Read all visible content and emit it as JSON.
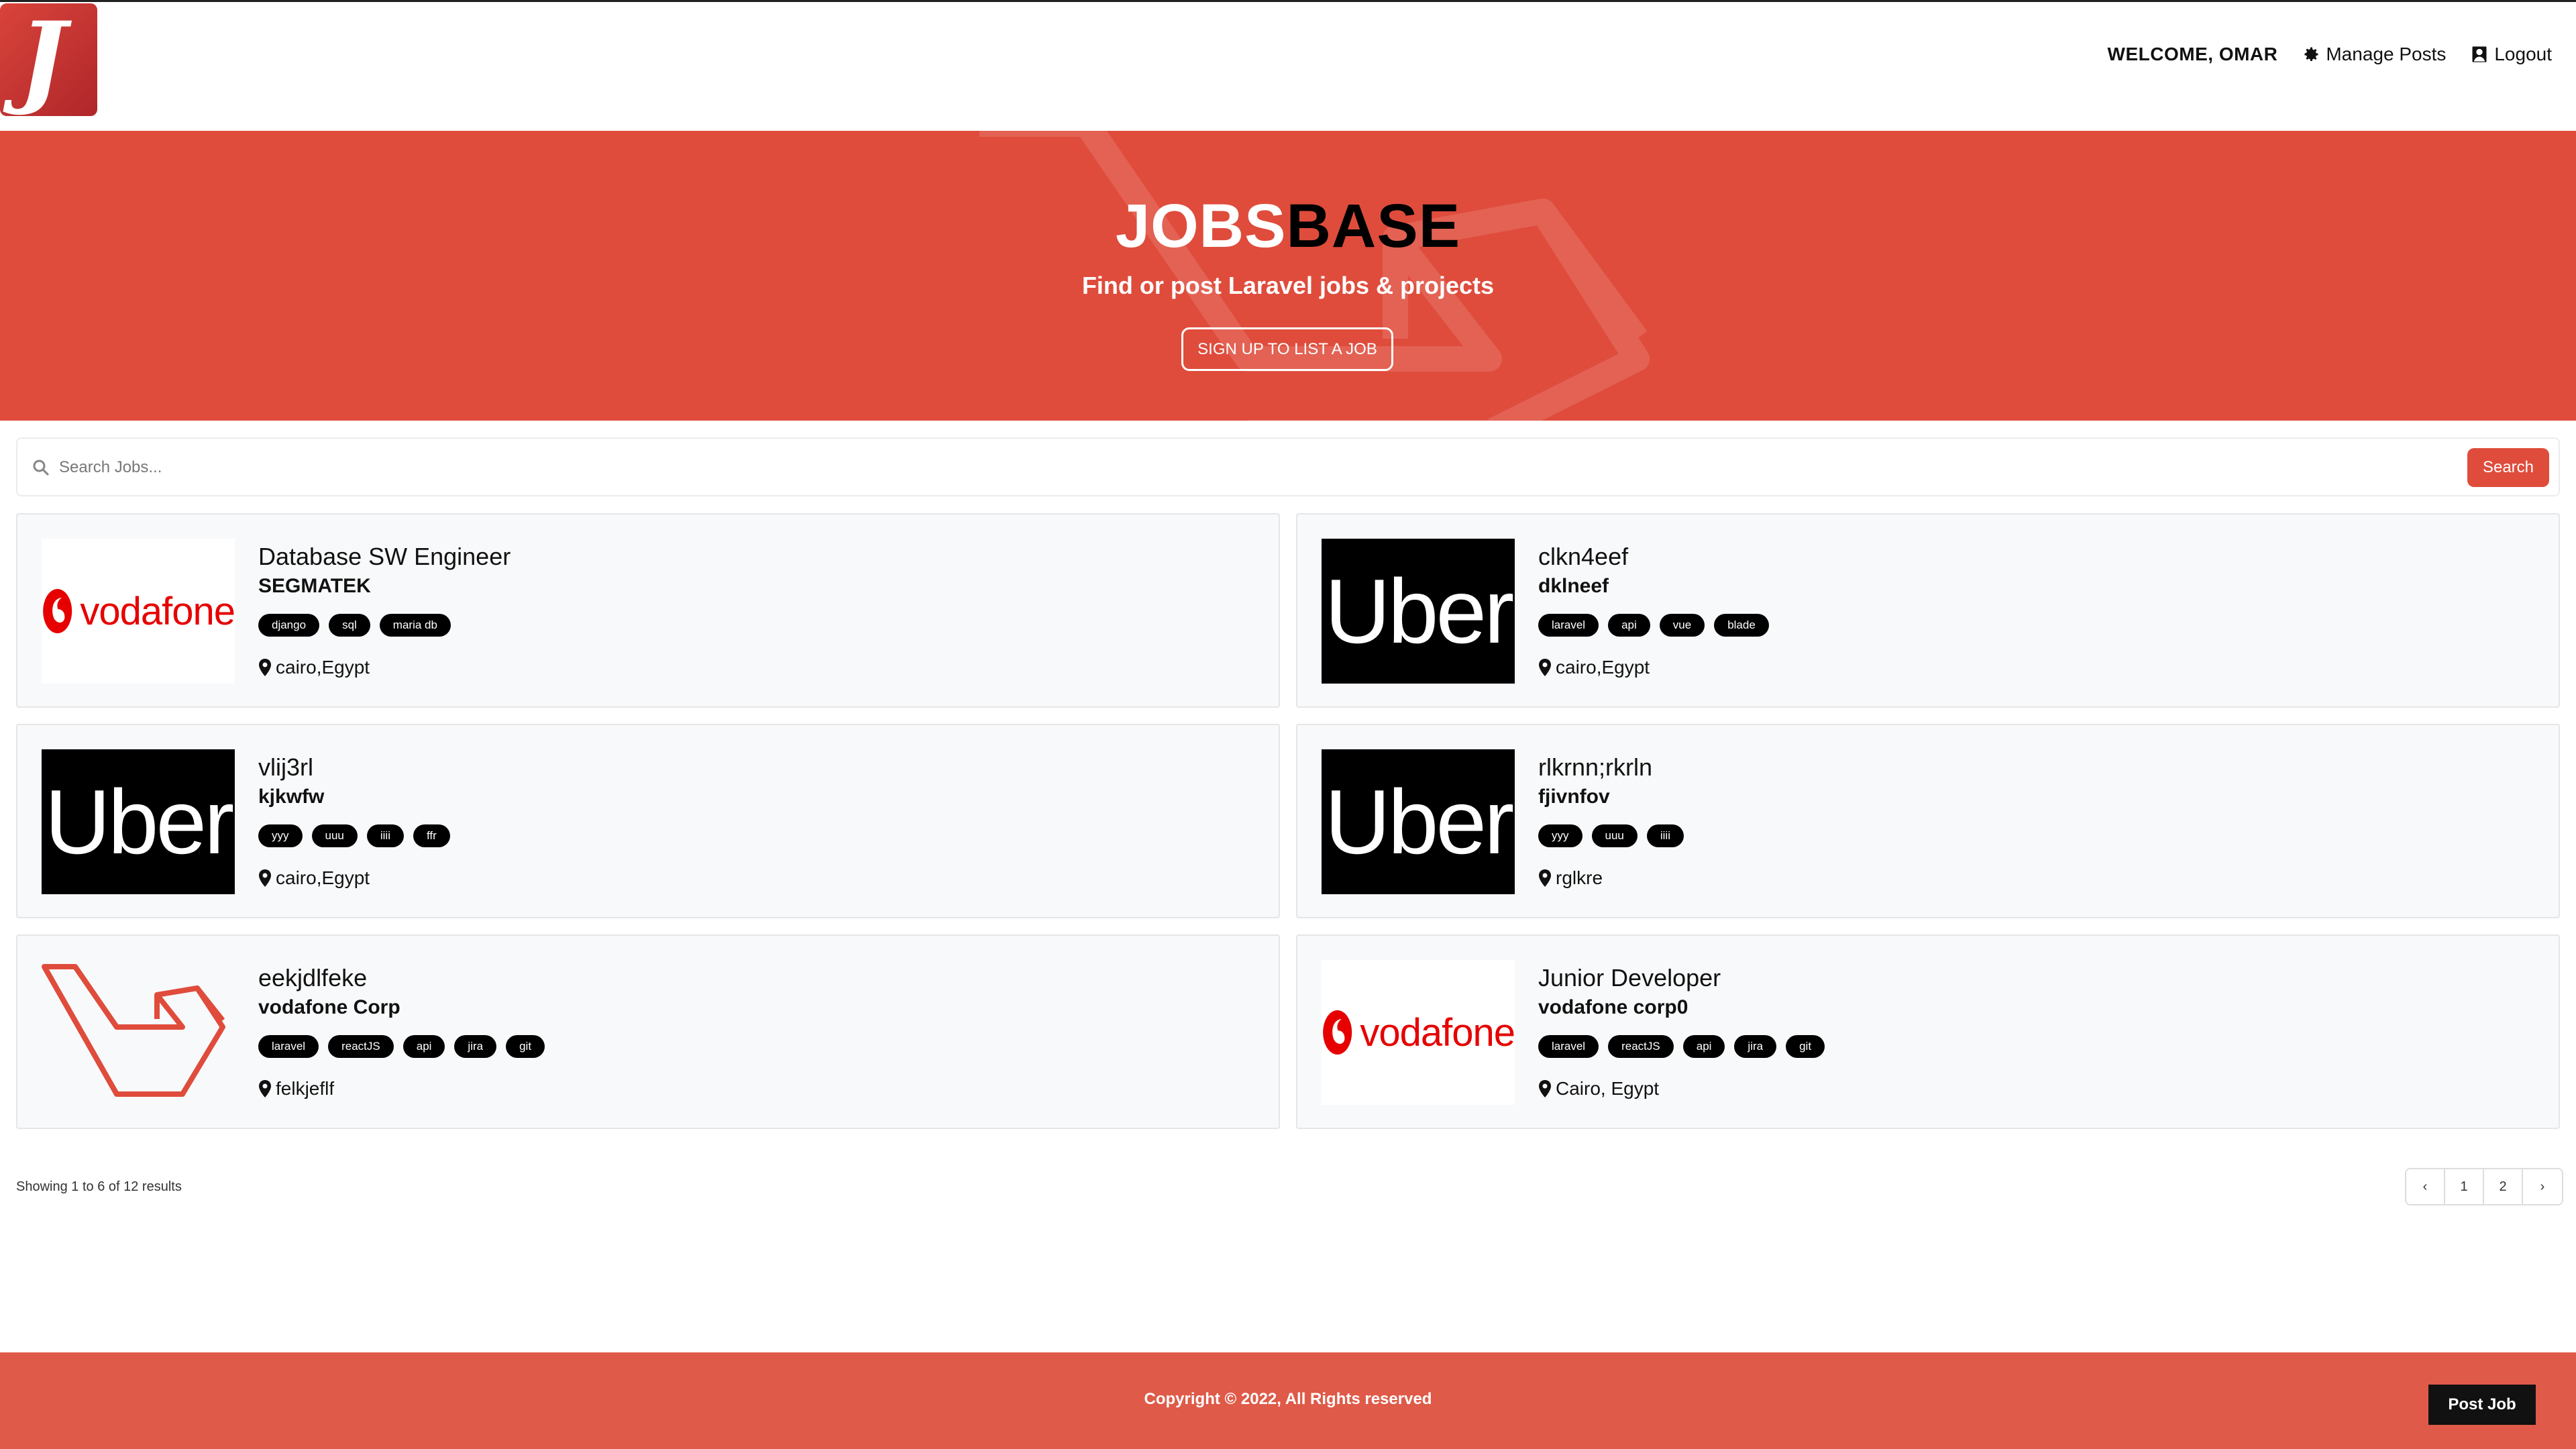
{
  "header": {
    "welcome": "WELCOME, OMAR",
    "manage_posts": "Manage Posts",
    "logout": "Logout",
    "logo_letter": "J"
  },
  "hero": {
    "brand_part1": "JOBS",
    "brand_part2": "BASE",
    "tagline": "Find or post Laravel jobs & projects",
    "signup_label": "SIGN UP TO LIST A JOB"
  },
  "search": {
    "placeholder": "Search Jobs...",
    "button_label": "Search"
  },
  "jobs": [
    {
      "title": "Database SW Engineer",
      "company": "SEGMATEK",
      "tags": [
        "django",
        "sql",
        "maria db"
      ],
      "location": "cairo,Egypt",
      "logo": "vodafone"
    },
    {
      "title": "clkn4eef",
      "company": "dklneef",
      "tags": [
        "laravel",
        "api",
        "vue",
        "blade"
      ],
      "location": "cairo,Egypt",
      "logo": "uber"
    },
    {
      "title": "vlij3rl",
      "company": "kjkwfw",
      "tags": [
        "yyy",
        "uuu",
        "iiii",
        "ffr"
      ],
      "location": "cairo,Egypt",
      "logo": "uber"
    },
    {
      "title": "rlkrnn;rkrln",
      "company": "fjivnfov",
      "tags": [
        "yyy",
        "uuu",
        "iiii"
      ],
      "location": "rglkre",
      "logo": "uber"
    },
    {
      "title": "eekjdlfeke",
      "company": "vodafone Corp",
      "tags": [
        "laravel",
        "reactJS",
        "api",
        "jira",
        "git"
      ],
      "location": "felkjeflf",
      "logo": "laravel"
    },
    {
      "title": "Junior Developer",
      "company": "vodafone corp0",
      "tags": [
        "laravel",
        "reactJS",
        "api",
        "jira",
        "git"
      ],
      "location": "Cairo, Egypt",
      "logo": "vodafone"
    }
  ],
  "logo_text": {
    "uber": "Uber",
    "vodafone": "vodafone"
  },
  "pagination": {
    "summary": "Showing 1 to 6 of 12 results",
    "prev": "‹",
    "pages": [
      "1",
      "2"
    ],
    "next": "›"
  },
  "footer": {
    "copyright": "Copyright © 2022, All Rights reserved",
    "post_job": "Post Job"
  },
  "colors": {
    "brand_red": "#df4c3c",
    "footer_red": "#df5a48",
    "vodafone_red": "#e60000"
  }
}
